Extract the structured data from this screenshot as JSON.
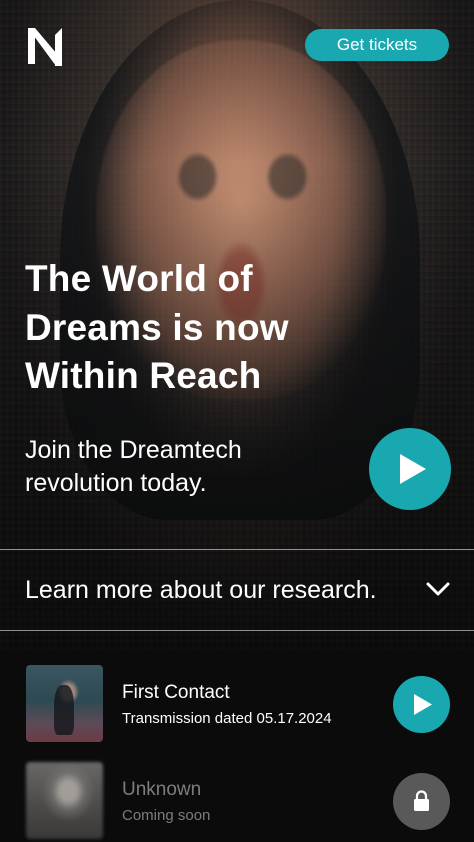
{
  "header": {
    "logo_icon": "n-logo-icon",
    "tickets_label": "Get tickets"
  },
  "hero": {
    "title": "The World of Dreams is now Within Reach",
    "subtitle": "Join the Dreamtech revolution today.",
    "play_icon": "play-icon"
  },
  "learn_more": {
    "label": "Learn more about our research.",
    "icon": "chevron-down-icon"
  },
  "tracks": [
    {
      "title": "First Contact",
      "subtitle": "Transmission dated 05.17.2024",
      "action_icon": "play-icon",
      "locked": false
    },
    {
      "title": "Unknown",
      "subtitle": "Coming soon",
      "action_icon": "lock-icon",
      "locked": true
    }
  ],
  "colors": {
    "accent": "#1aa8b0",
    "background": "#0b0b0c",
    "locked_button": "#595959",
    "locked_text": "#7d7d7d"
  }
}
